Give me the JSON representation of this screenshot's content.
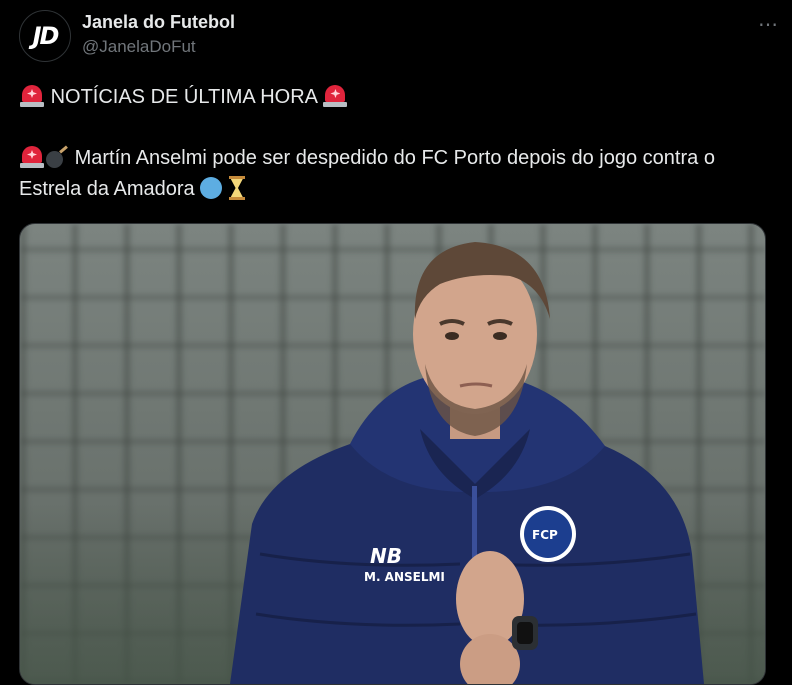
{
  "account": {
    "name": "Janela do Futebol",
    "handle": "@JanelaDoFut",
    "avatar_logo": "JD",
    "more_icon": "⋯"
  },
  "tweet": {
    "line1_text": "NOTÍCIAS DE ÚLTIMA HORA",
    "line2_text": "Martín Anselmi pode ser despedido do FC Porto depois do jogo contra o Estrela da Amadora",
    "emojis": [
      "rotating-light-icon",
      "bomb-icon",
      "blue-circle-icon",
      "hourglass-icon"
    ]
  },
  "media": {
    "jacket_logo": "NB",
    "jacket_name": "M. ANSELMI",
    "crest_text": "FCP"
  },
  "colors": {
    "background": "#000000",
    "text": "#e7e9ea",
    "secondary": "#71767b",
    "jacket": "#1f2d63"
  }
}
